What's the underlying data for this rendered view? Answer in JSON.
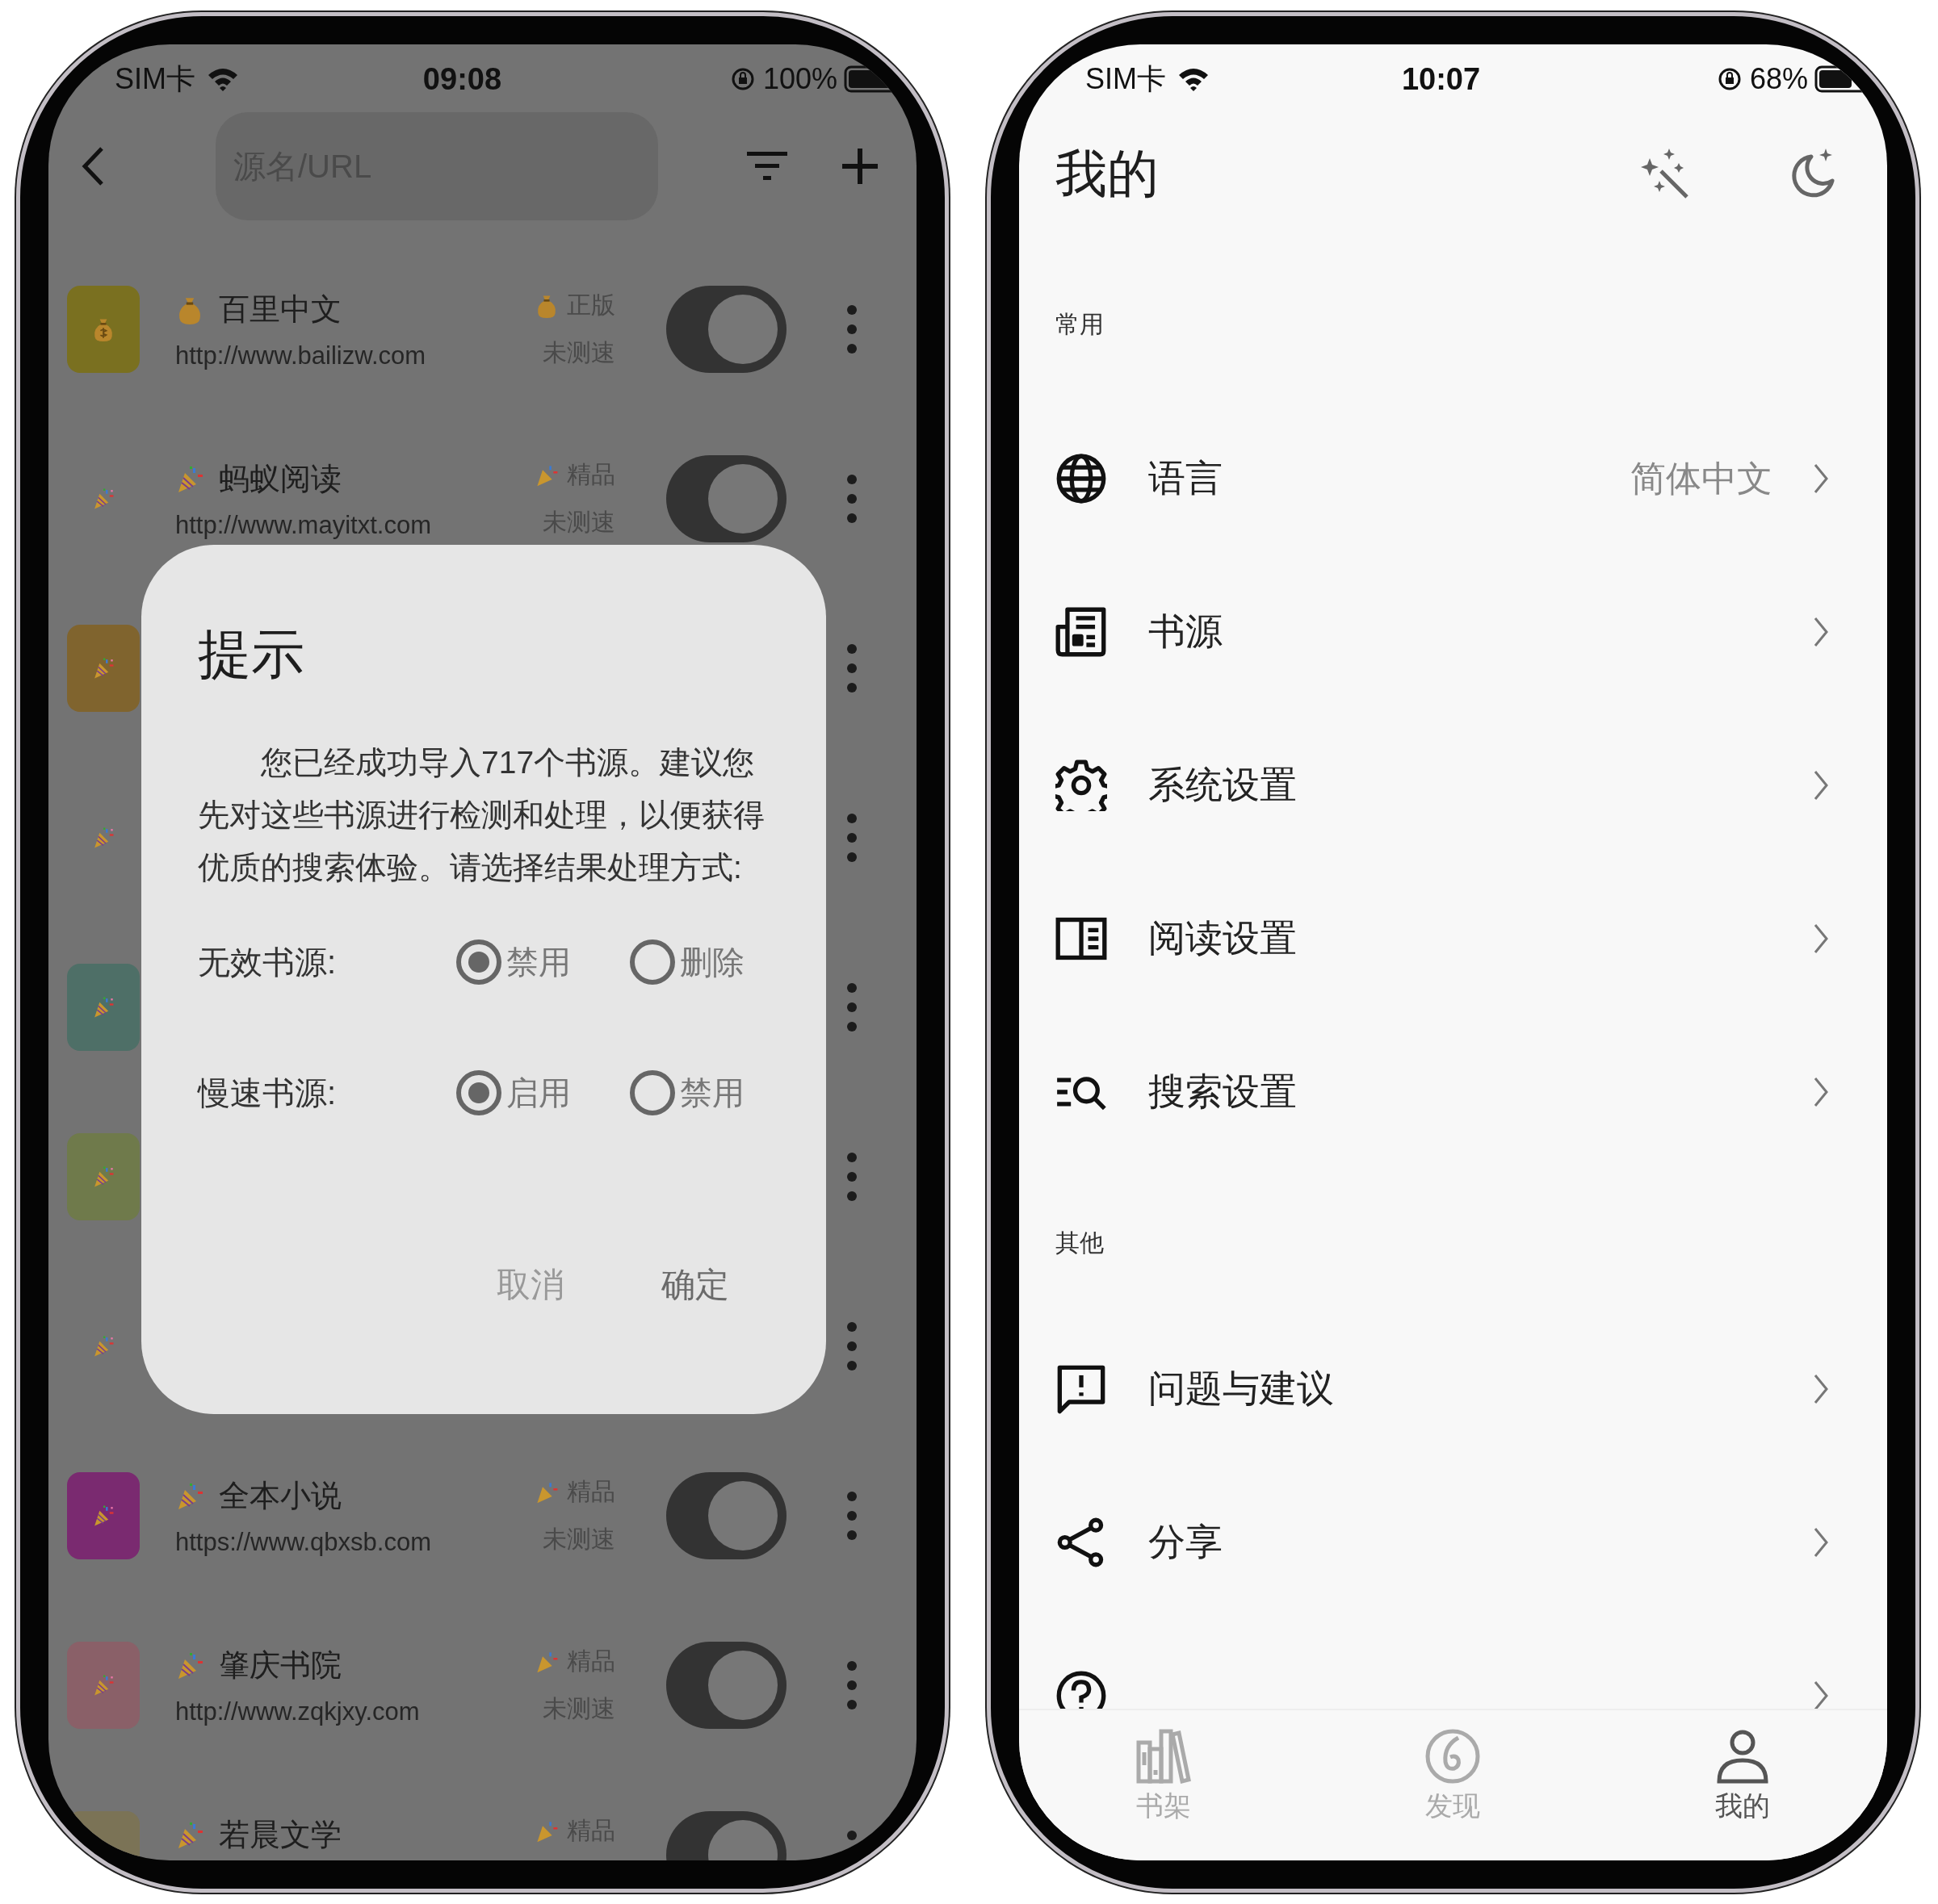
{
  "left_phone": {
    "status_bar": {
      "carrier": "SIM卡",
      "time": "09:08",
      "battery": "100%"
    },
    "search": {
      "placeholder": "源名/URL"
    },
    "sources": [
      {
        "kind": "money",
        "color": "#7a7020",
        "name": "百里中文",
        "url": "http://www.bailizw.com",
        "tag": "正版",
        "speed": "未测速",
        "on": true
      },
      {
        "kind": "party",
        "name": "蚂蚁阅读",
        "url": "http://www.mayitxt.com",
        "tag": "精品",
        "speed": "未测速",
        "on": true
      },
      {
        "kind": "party",
        "color": "#80642e"
      },
      {
        "kind": "party"
      },
      {
        "kind": "party",
        "color": "#4e6f67"
      },
      {
        "kind": "party",
        "color": "#6f7a4b"
      },
      {
        "kind": "party"
      },
      {
        "kind": "party",
        "color": "#7a2a70",
        "name": "全本小说",
        "url": "https://www.qbxsb.com",
        "tag": "精品",
        "speed": "未测速",
        "on": true
      },
      {
        "kind": "party",
        "color": "#8a6068",
        "name": "肇庆书院",
        "url": "http://www.zqkjxy.com",
        "tag": "精品",
        "speed": "未测速",
        "on": true
      },
      {
        "kind": "party",
        "color": "#7b7356",
        "name": "若晨文学",
        "tag": "精品",
        "on": true
      }
    ],
    "dialog": {
      "title": "提示",
      "message": "您已经成功导入717个书源。建议您先对这些书源进行检测和处理，以便获得优质的搜索体验。请选择结果处理方式:",
      "options": [
        {
          "label": "无效书源:",
          "choices": [
            {
              "label": "禁用",
              "selected": true
            },
            {
              "label": "删除",
              "selected": false
            }
          ]
        },
        {
          "label": "慢速书源:",
          "choices": [
            {
              "label": "启用",
              "selected": true
            },
            {
              "label": "禁用",
              "selected": false
            }
          ]
        }
      ],
      "buttons": [
        {
          "label": "取消",
          "kind": "cancel"
        },
        {
          "label": "确定",
          "kind": "confirm"
        }
      ]
    }
  },
  "right_phone": {
    "status_bar": {
      "carrier": "SIM卡",
      "time": "10:07",
      "battery": "68%"
    },
    "title": "我的",
    "sections": [
      {
        "title": "常用",
        "items": [
          {
            "kind": "globe",
            "label": "语言",
            "value": "简体中文"
          },
          {
            "kind": "document",
            "label": "书源"
          },
          {
            "kind": "gear",
            "label": "系统设置"
          },
          {
            "kind": "reading",
            "label": "阅读设置"
          },
          {
            "kind": "search",
            "label": "搜索设置"
          }
        ]
      },
      {
        "title": "其他",
        "items": [
          {
            "kind": "feedback",
            "label": "问题与建议"
          },
          {
            "kind": "share",
            "label": "分享"
          },
          {
            "kind": "help"
          }
        ]
      }
    ],
    "nav": [
      {
        "kind": "shelf",
        "label": "书架",
        "selected": false
      },
      {
        "kind": "discover",
        "label": "发现",
        "selected": false
      },
      {
        "kind": "person",
        "label": "我的",
        "selected": true
      }
    ]
  }
}
